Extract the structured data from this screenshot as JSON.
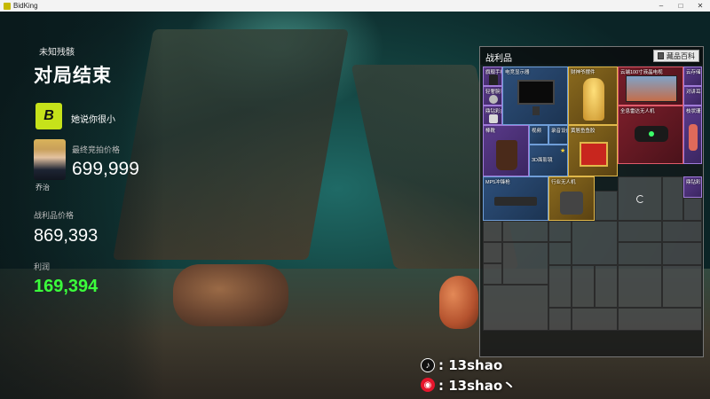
{
  "window": {
    "title": "BidKing",
    "controls": [
      "–",
      "□",
      "✕"
    ]
  },
  "results": {
    "subtitle": "未知残骸",
    "title": "对局结束",
    "player_name": "她说你很小",
    "player_logo_text": "B",
    "npc_name": "乔治",
    "final_bid_label": "最终竞拍价格",
    "final_bid_value": "699,999",
    "loot_value_label": "战利品价格",
    "loot_value": "869,393",
    "profit_label": "利润",
    "profit_value": "169,394",
    "profit_color": "#3bff3b"
  },
  "loot": {
    "title": "战利品",
    "codex_button": "藏品百科",
    "items": [
      {
        "name": "旗舰手机",
        "rarity": "purple",
        "icon": "phone-icon"
      },
      {
        "name": "电竞显示器",
        "rarity": "blue",
        "icon": "monitor-icon"
      },
      {
        "name": "财神爷摆件",
        "rarity": "gold",
        "icon": "statue-icon"
      },
      {
        "name": "云端100寸液晶电视",
        "rarity": "red",
        "icon": "tv-icon"
      },
      {
        "name": "云存储",
        "rarity": "purple",
        "icon": "cloud-storage-icon"
      },
      {
        "name": "轻奢腕表",
        "rarity": "purple",
        "icon": "watch-icon"
      },
      {
        "name": "鼎钻彩盒",
        "rarity": "purple",
        "icon": "gift-box-icon"
      },
      {
        "name": "全息雷达无人机",
        "rarity": "red",
        "icon": "drone-icon"
      },
      {
        "name": "对讲耳机",
        "rarity": "purple",
        "icon": "headset-icon"
      },
      {
        "name": "枝状珊瑚",
        "rarity": "purple",
        "icon": "coral-icon"
      },
      {
        "name": "棒靴",
        "rarity": "purple",
        "icon": "boots-icon"
      },
      {
        "name": "视频",
        "rarity": "blue",
        "icon": "video-icon"
      },
      {
        "name": "录音设备",
        "rarity": "blue",
        "icon": "recorder-icon"
      },
      {
        "name": "3D面影镜",
        "rarity": "blue",
        "icon": "mirror-icon"
      },
      {
        "name": "黄唇鱼鱼胶",
        "rarity": "gold",
        "icon": "fish-maw-icon"
      },
      {
        "name": "MP5冲锋枪",
        "rarity": "blue",
        "icon": "smg-icon"
      },
      {
        "name": "行业无人机",
        "rarity": "gold",
        "icon": "industrial-drone-icon"
      },
      {
        "name": "鼎钻彩盒",
        "rarity": "purple",
        "icon": "gift-box-icon"
      }
    ]
  },
  "watermark": [
    {
      "icon": "tiktok-icon",
      "text": ": 13shao"
    },
    {
      "icon": "weibo-icon",
      "text": ": 13shao丶"
    }
  ],
  "colors": {
    "purple": "#5a3a8a",
    "blue": "#2d4f7a",
    "gold": "#8a6a1e",
    "red": "#7a1e2a",
    "empty": "#8c8c8c"
  }
}
